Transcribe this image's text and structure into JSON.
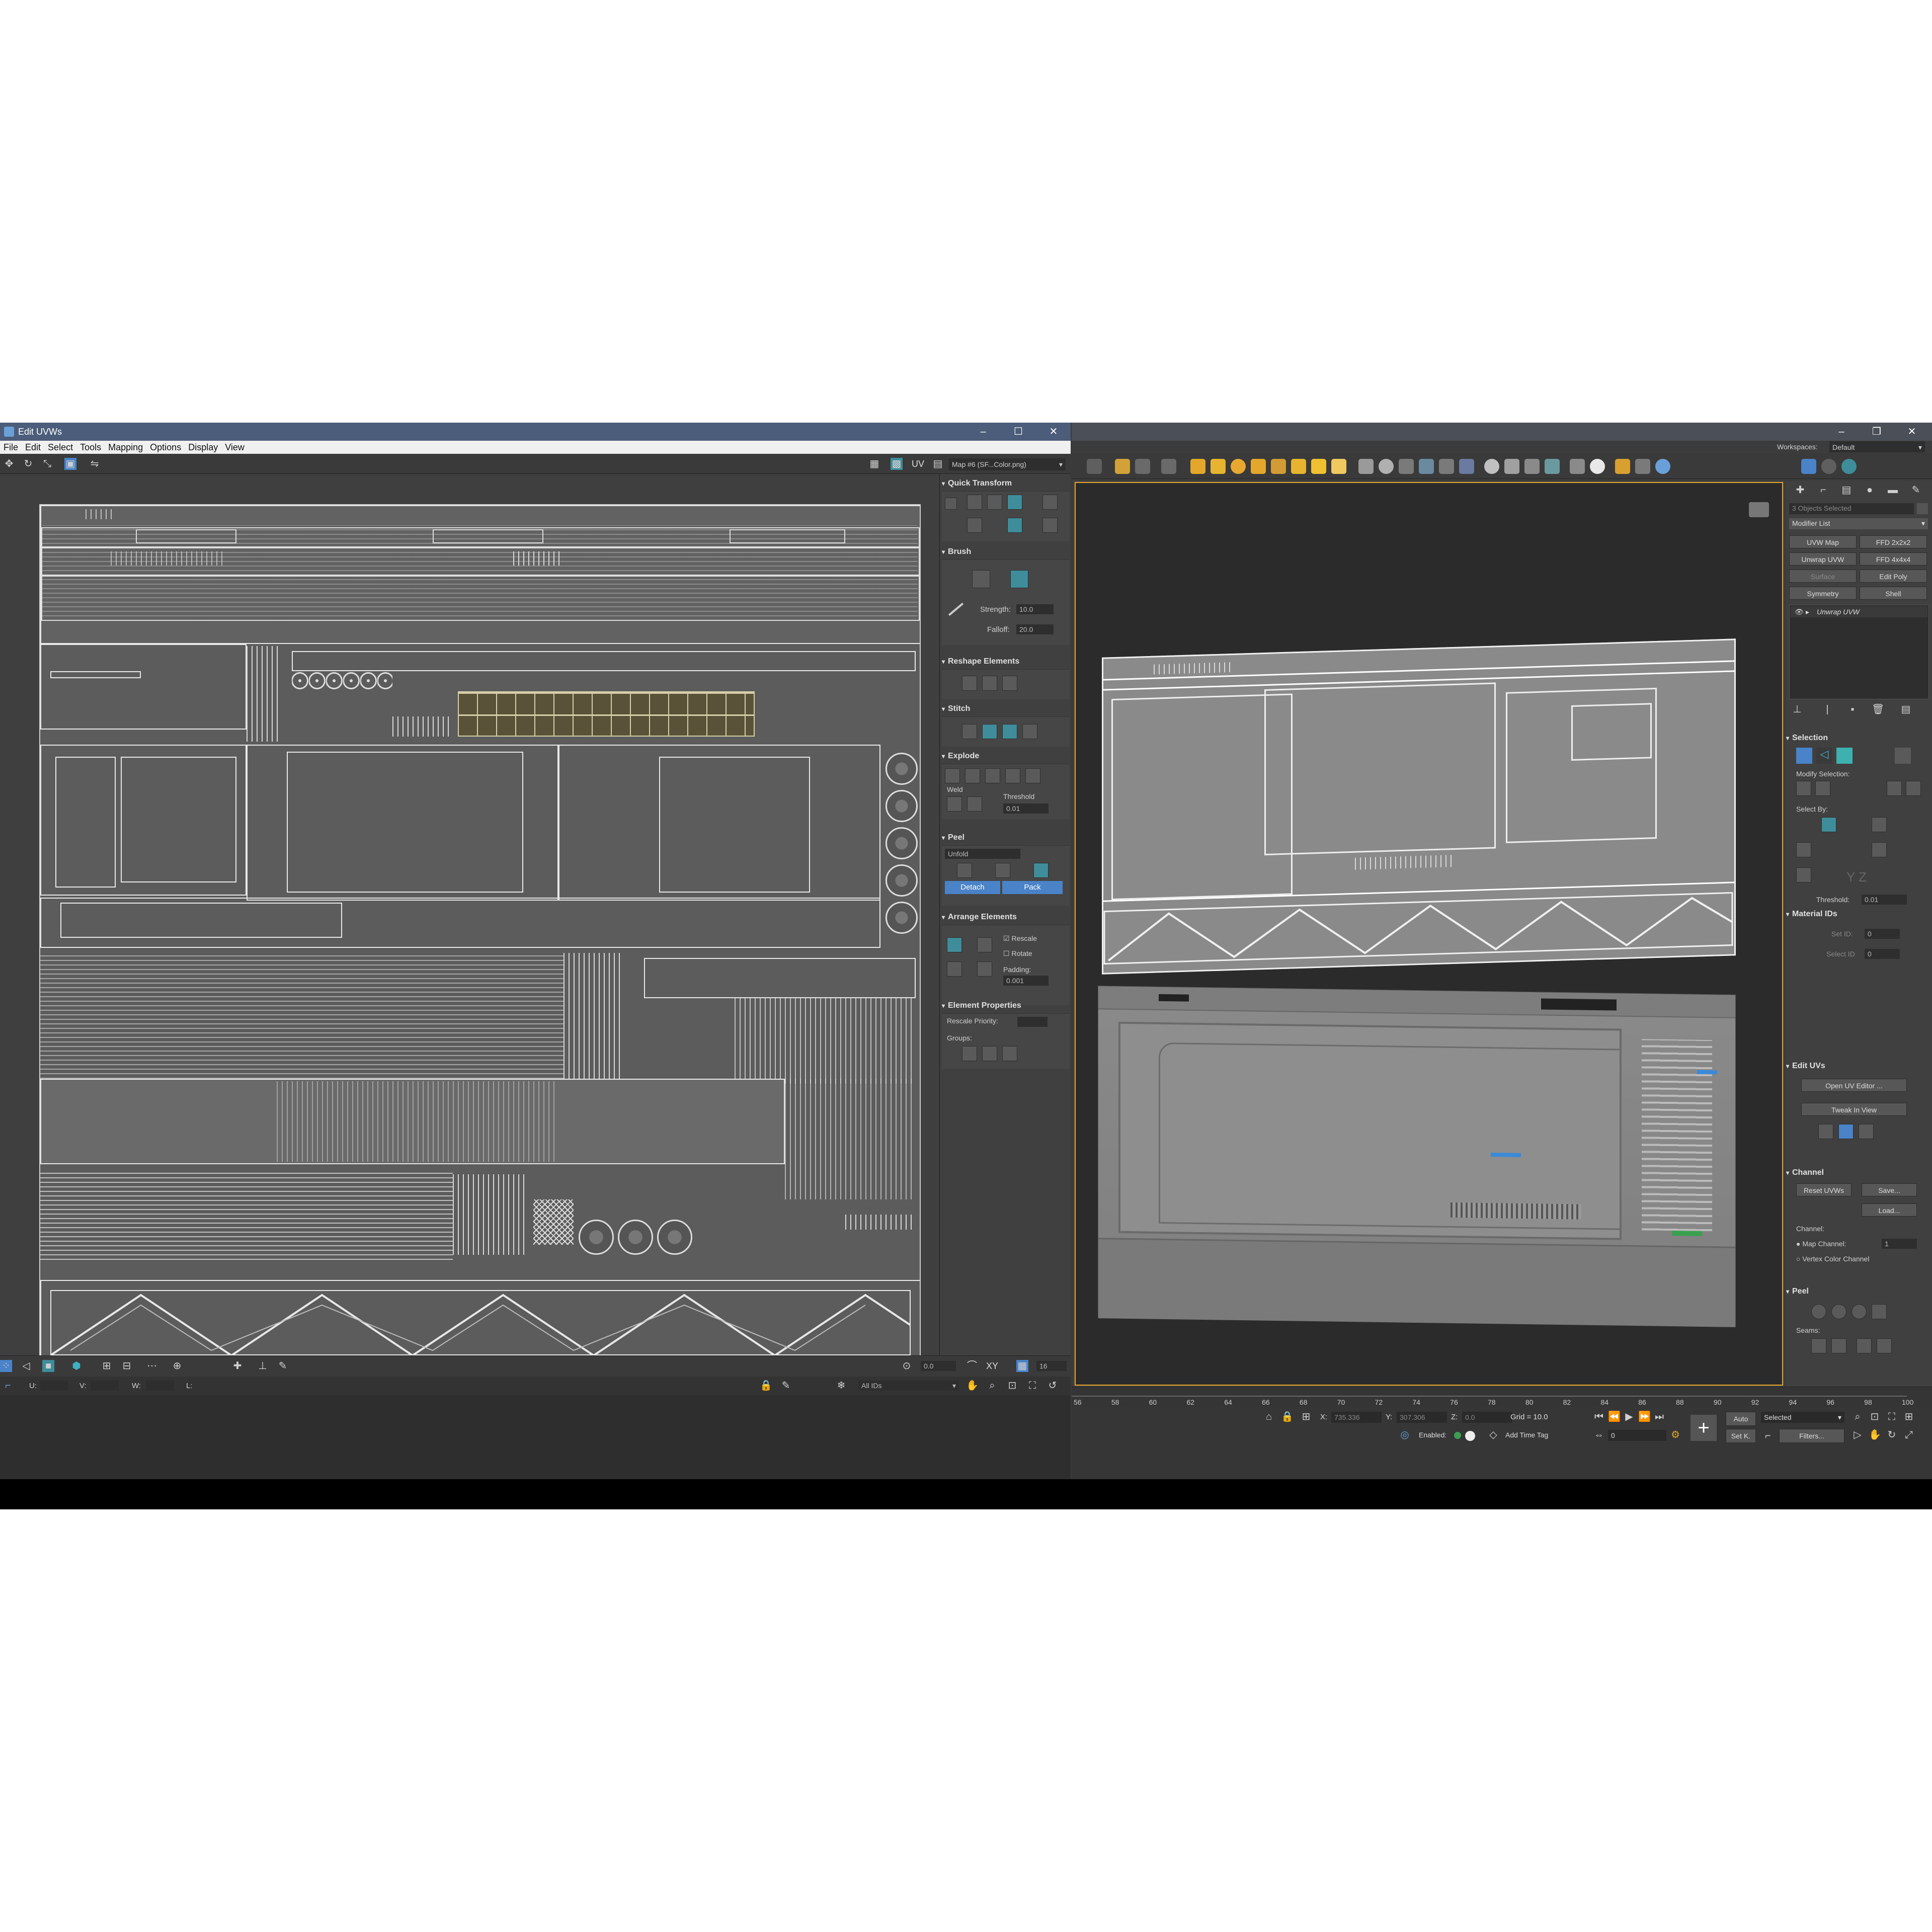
{
  "uv_window": {
    "title": "Edit UVWs",
    "controls": [
      "–",
      "☐",
      "✕"
    ],
    "menu": [
      "File",
      "Edit",
      "Select",
      "Tools",
      "Mapping",
      "Options",
      "Display",
      "View"
    ],
    "toolbar_uv_label": "UV",
    "map_dropdown": "Map #6 (SF...Color.png)"
  },
  "uv_panel": {
    "quick_transform": "Quick Transform",
    "brush": "Brush",
    "strength_label": "Strength:",
    "strength_value": "10.0",
    "falloff_label": "Falloff:",
    "falloff_value": "20.0",
    "reshape": "Reshape Elements",
    "stitch": "Stitch",
    "explode": "Explode",
    "weld": "Weld",
    "threshold_label": "Threshold",
    "threshold_value": "0.01",
    "peel": "Peel",
    "unfold": "Unfold",
    "detach": "Detach",
    "pack": "Pack",
    "arrange": "Arrange Elements",
    "rescale": "Rescale",
    "rotate": "Rotate",
    "padding_label": "Padding:",
    "padding_value": "0.001",
    "element_props": "Element Properties",
    "rescale_priority": "Rescale Priority:",
    "groups": "Groups:"
  },
  "uv_bottom": {
    "zoom_value": "0.0",
    "xy": "XY",
    "grid_value": "16",
    "u_label": "U:",
    "v_label": "V:",
    "w_label": "W:",
    "l_label": "L:",
    "ids_dropdown": "All IDs"
  },
  "max_window": {
    "workspaces_label": "Workspaces:",
    "workspace_value": "Default",
    "controls": [
      "–",
      "❐",
      "✕"
    ]
  },
  "command_panel": {
    "objects_selected": "3 Objects Selected",
    "modifier_list": "Modifier List",
    "buttons": [
      [
        "UVW Map",
        "FFD 2x2x2"
      ],
      [
        "Unwrap UVW",
        "FFD 4x4x4"
      ],
      [
        "Surface",
        "Edit Poly"
      ],
      [
        "Symmetry",
        "Shell"
      ]
    ],
    "stack_item": "Unwrap UVW",
    "selection": "Selection",
    "modify_selection": "Modify Selection:",
    "select_by": "Select By:",
    "threshold_label": "Threshold:",
    "threshold_value": "0.01",
    "material_ids": "Material IDs",
    "set_id": "Set ID:",
    "select_id": "Select ID",
    "set_id_value": "0",
    "edit_uvs": "Edit UVs",
    "open_uv_editor": "Open UV Editor ...",
    "tweak_in_view": "Tweak In View",
    "channel": "Channel",
    "reset_uvws": "Reset UVWs",
    "save": "Save...",
    "load": "Load...",
    "channel_label": "Channel:",
    "map_channel": "Map Channel:",
    "map_channel_value": "1",
    "vertex_color_channel": "Vertex Color Channel",
    "peel": "Peel",
    "seams": "Seams:"
  },
  "timeline_ticks": [
    "56",
    "58",
    "60",
    "62",
    "64",
    "66",
    "68",
    "70",
    "72",
    "74",
    "76",
    "78",
    "80",
    "82",
    "84",
    "86",
    "88",
    "90",
    "92",
    "94",
    "96",
    "98",
    "100"
  ],
  "max_status": {
    "x_label": "X:",
    "x_value": "735.336",
    "y_label": "Y:",
    "y_value": "307.306",
    "z_label": "Z:",
    "z_value": "0.0",
    "grid": "Grid = 10.0",
    "enabled": "Enabled:",
    "add_time_tag": "Add Time Tag",
    "auto": "Auto",
    "selected": "Selected",
    "set_k": "Set K.",
    "filters": "Filters...",
    "frame_value": "0"
  },
  "colors": {
    "accent_blue": "#4a83c8",
    "viewport_border": "#e6a52a",
    "teal_icon": "#3f8d9a"
  }
}
